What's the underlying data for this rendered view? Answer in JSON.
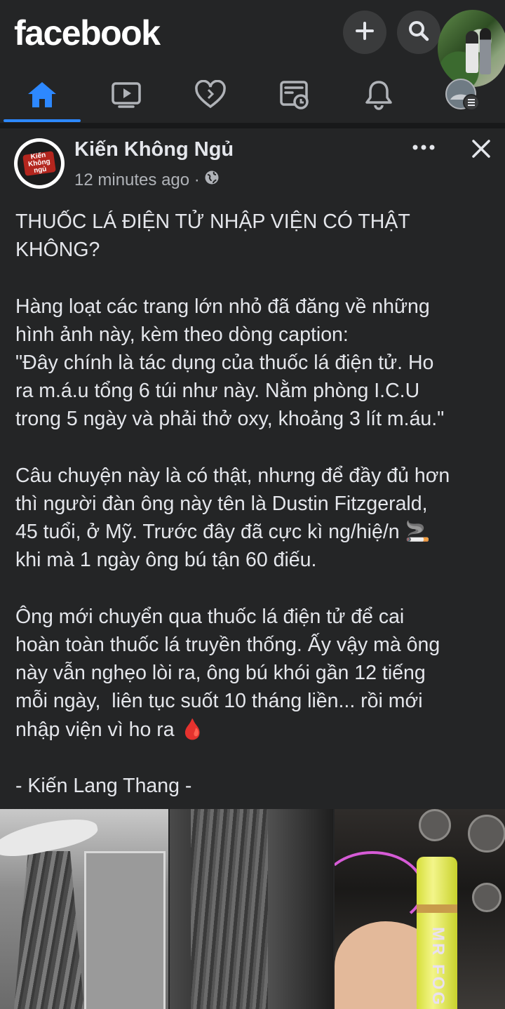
{
  "app": {
    "logo": "facebook"
  },
  "header": {
    "create_icon": "plus-icon",
    "search_icon": "search-icon",
    "profile_avatar": "profile-avatar"
  },
  "nav": {
    "tabs": [
      {
        "name": "home",
        "icon": "home-icon",
        "active": true
      },
      {
        "name": "watch",
        "icon": "video-icon",
        "active": false
      },
      {
        "name": "dating",
        "icon": "heart-icon",
        "active": false
      },
      {
        "name": "feeds",
        "icon": "feeds-icon",
        "active": false
      },
      {
        "name": "notifications",
        "icon": "bell-icon",
        "active": false
      },
      {
        "name": "menu",
        "icon": "menu-avatar-icon",
        "active": false
      }
    ],
    "active_color": "#2d88ff"
  },
  "post": {
    "author": "Kiến Không Ngủ",
    "avatar_text": "Kiến Không ngủ",
    "time": "12 minutes ago ·",
    "privacy_icon": "globe-icon",
    "text": "THUỐC LÁ ĐIỆN TỬ NHẬP VIỆN CÓ THẬT\nKHÔNG?\n\nHàng loạt các trang lớn nhỏ đã đăng về những\nhình ảnh này, kèm theo dòng caption:\n\"Đây chính là tác dụng của thuốc lá điện tử. Ho\nra m.á.u tổng 6 túi như này. Nằm phòng I.C.U\ntrong 5 ngày và phải thở oxy, khoảng 3 lít m.áu.\"\n\nCâu chuyện này là có thật, nhưng để đầy đủ hơn\nthì người đàn ông này tên là Dustin Fitzgerald,\n45 tuổi, ở Mỹ. Trước đây đã cực kì ng/hiệ/n 🚬\nkhi mà 1 ngày ông bú tận 60 điếu.\n\nÔng mới chuyển qua thuốc lá điện tử để cai\nhoàn toàn thuốc lá truyền thống. Ấy vậy mà ông\nnày vẫn nghẹo lòi ra, ông bú khói gần 12 tiếng\nmỗi ngày,  liên tục suốt 10 tháng liền... rồi mới\nnhập viện vì ho ra 🩸\n\n- Kiến Lang Thang -",
    "photos": [
      {
        "name": "photo-blood-bag"
      },
      {
        "name": "photo-close-up"
      },
      {
        "name": "photo-vape-device",
        "label": "MR FOG"
      }
    ]
  }
}
